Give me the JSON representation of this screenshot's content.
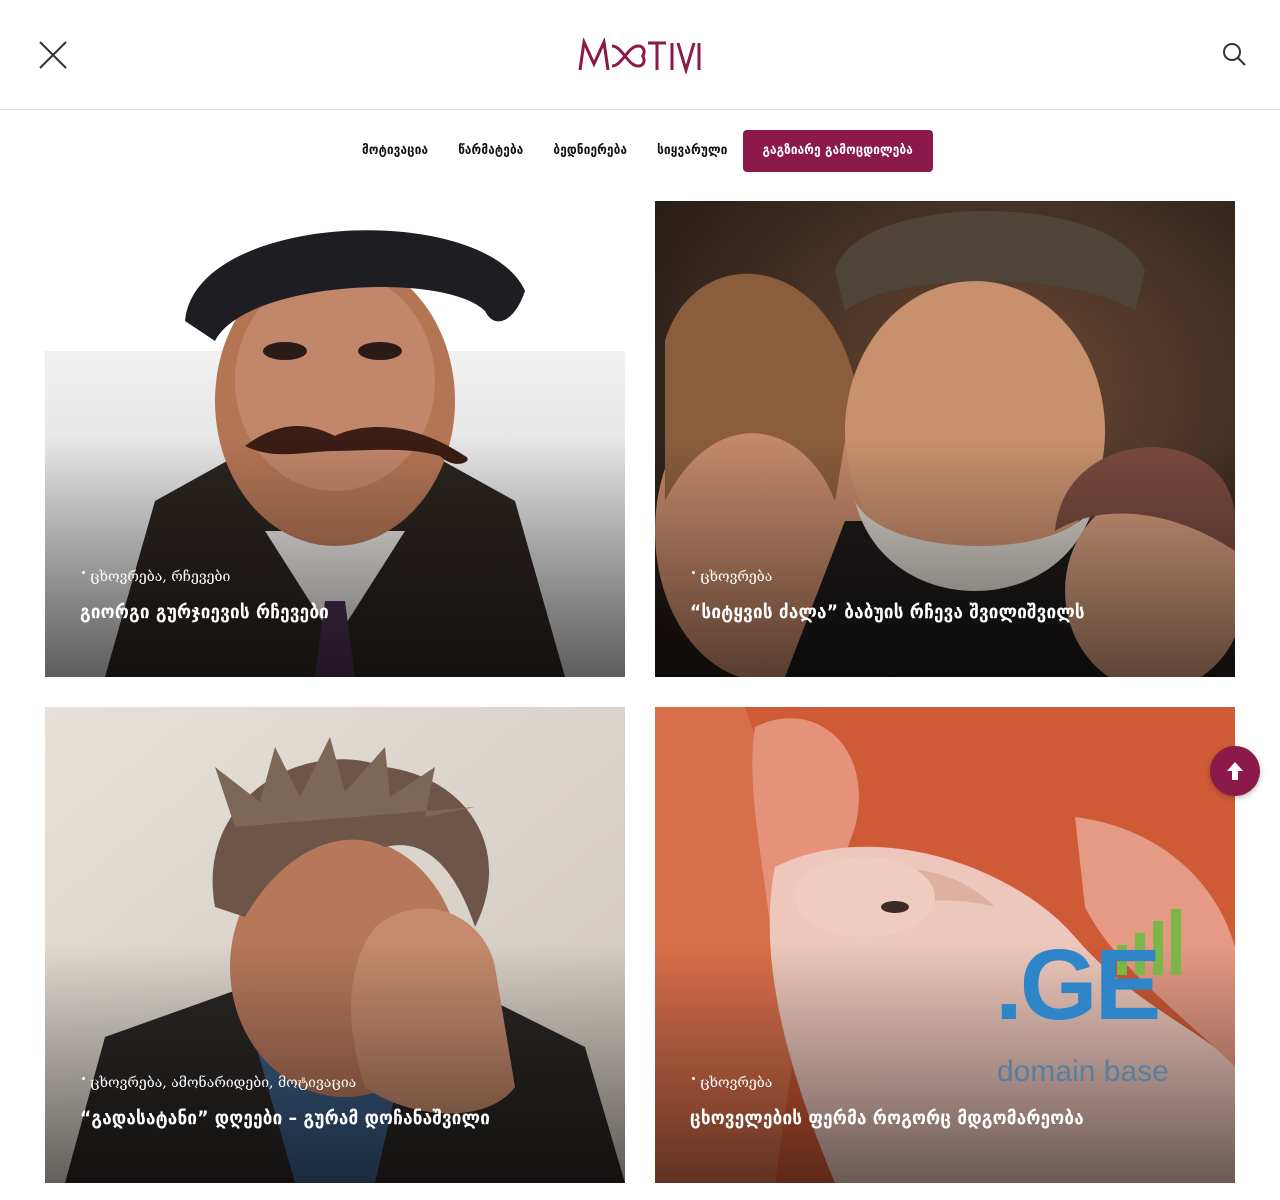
{
  "header": {
    "logo_text": "MOTIVI",
    "brand_color": "#8b1a4a",
    "close_icon": "close-icon",
    "search_icon": "search-icon"
  },
  "nav": {
    "items": [
      {
        "label": "მოტივაცია"
      },
      {
        "label": "წარმატება"
      },
      {
        "label": "ბედნიერება"
      },
      {
        "label": "სიყვარული"
      },
      {
        "label": "გაგზიარე გამოცდილება",
        "active": true
      }
    ]
  },
  "cards": [
    {
      "categories": "ცხოვრება, რჩევები",
      "title": "გიორგი გურჯიევის რჩევები"
    },
    {
      "categories": "ცხოვრება",
      "title": "“სიტყვის ძალა” ბაბუის რჩევა შვილიშვილს"
    },
    {
      "categories": "ცხოვრება, ამონარიდები, მოტივაცია",
      "title": "“გადასატანი” დღეები – გურამ დოჩანაშვილი"
    },
    {
      "categories": "ცხოვრება",
      "title": "ცხოველების ფერმა როგორც მდგომარეობა"
    }
  ],
  "watermark": {
    "text": ".GE",
    "subtext": "domain base"
  },
  "scroll_top": {
    "icon": "arrow-up-icon"
  }
}
